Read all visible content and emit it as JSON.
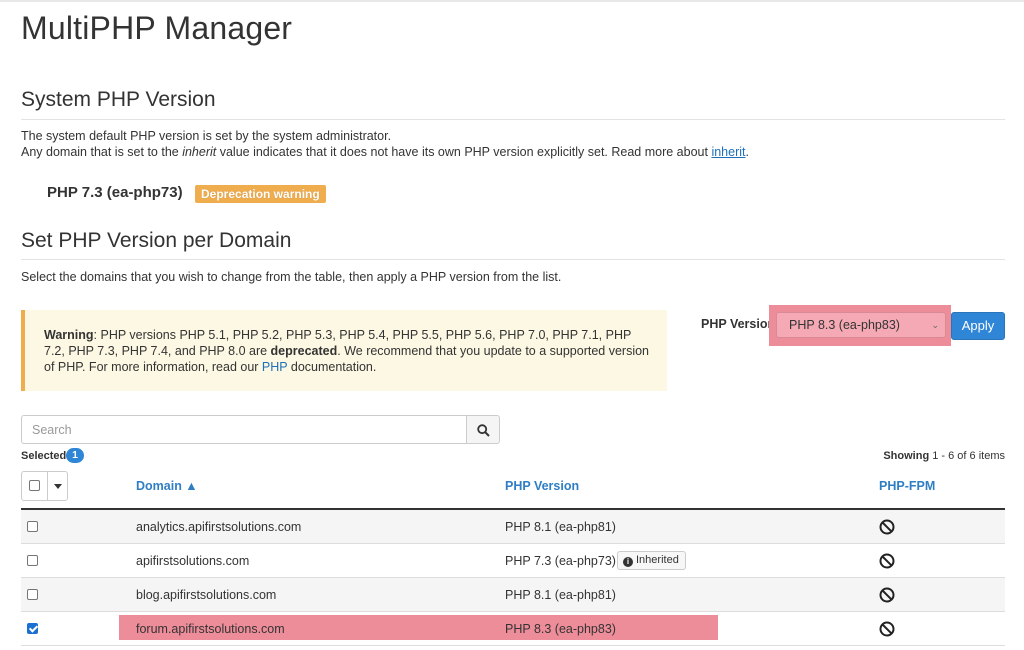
{
  "page": {
    "title": "MultiPHP Manager"
  },
  "system": {
    "heading": "System PHP Version",
    "desc_line1": "The system default PHP version is set by the system administrator.",
    "desc_line2_pre": "Any domain that is set to the ",
    "desc_line2_em": "inherit",
    "desc_line2_mid": " value indicates that it does not have its own PHP version explicitly set. Read more about ",
    "desc_line2_link": "inherit",
    "desc_line2_post": ".",
    "current_version": "PHP 7.3 (ea-php73)",
    "badge": "Deprecation warning"
  },
  "per_domain": {
    "heading": "Set PHP Version per Domain",
    "desc": "Select the domains that you wish to change from the table, then apply a PHP version from the list."
  },
  "warning": {
    "label": "Warning",
    "text1": ": PHP versions PHP 5.1, PHP 5.2, PHP 5.3, PHP 5.4, PHP 5.5, PHP 5.6, PHP 7.0, PHP 7.1, PHP 7.2, PHP 7.3, PHP 7.4, and PHP 8.0 are ",
    "bold": "deprecated",
    "text2": ". We recommend that you update to a supported version of PHP. For more information, read our ",
    "link": "PHP",
    "text3": " documentation."
  },
  "version_picker": {
    "label": "PHP Version",
    "selected": "PHP 8.3 (ea-php83)",
    "apply_label": "Apply"
  },
  "search": {
    "placeholder": "Search"
  },
  "selection": {
    "label": "Selected",
    "count": "1"
  },
  "showing": {
    "prefix": "Showing",
    "range": "1 - 6 of 6 items"
  },
  "table": {
    "columns": {
      "domain": "Domain ▲",
      "php_version": "PHP Version",
      "php_fpm": "PHP-FPM"
    },
    "rows": [
      {
        "domain": "analytics.apifirstsolutions.com",
        "php_version": "PHP 8.1 (ea-php81)",
        "checked": false
      },
      {
        "domain": "apifirstsolutions.com",
        "php_version": "PHP 7.3 (ea-php73)",
        "badge": "Inherited",
        "checked": false
      },
      {
        "domain": "blog.apifirstsolutions.com",
        "php_version": "PHP 8.1 (ea-php81)",
        "checked": false
      },
      {
        "domain": "forum.apifirstsolutions.com",
        "php_version": "PHP 8.3 (ea-php83)",
        "checked": true
      }
    ]
  },
  "colors": {
    "accent": "#2f86d7",
    "highlight": "#ee8d9a",
    "warning": "#f0ad4e",
    "warning_bg": "#fcf8e3"
  }
}
